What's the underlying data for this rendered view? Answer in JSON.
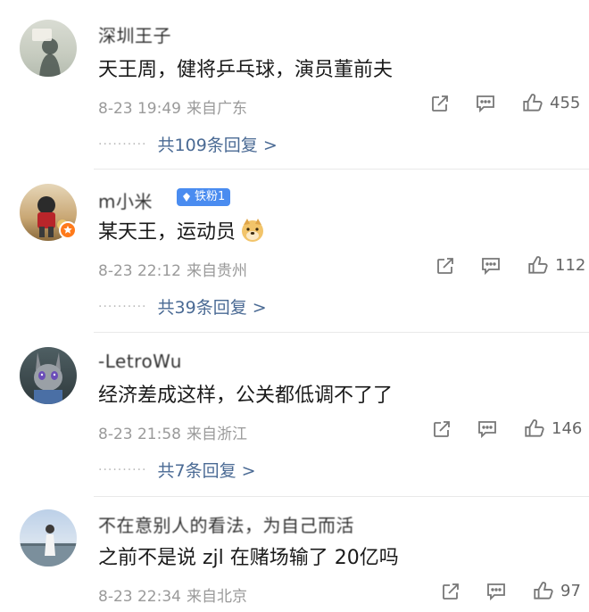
{
  "comments": [
    {
      "username": "深圳王子",
      "badge": "",
      "text": "天王周，健将乒乓球，演员董前夫",
      "date": "8-23 19:49",
      "location": "来自广东",
      "likes": "455",
      "replies": "共109条回复 >"
    },
    {
      "username": "m小米",
      "badge": "铁粉1",
      "text": "某天王，运动员",
      "date": "8-23 22:12",
      "location": "来自贵州",
      "likes": "112",
      "replies": "共39条回复 >"
    },
    {
      "username": "-LetroWu",
      "badge": "",
      "text": "经济差成这样，公关都低调不了了",
      "date": "8-23 21:58",
      "location": "来自浙江",
      "likes": "146",
      "replies": "共7条回复 >"
    },
    {
      "username": "不在意别人的看法，为自己而活",
      "badge": "",
      "text": "之前不是说 zjl 在赌场输了 20亿吗",
      "date": "8-23 22:34",
      "location": "来自北京",
      "likes": "97",
      "replies": ""
    }
  ],
  "dots": "··········",
  "icons": [
    "share-icon",
    "comment-icon",
    "thumbs-up-icon"
  ],
  "colors": {
    "link": "#4a6a94",
    "meta": "#9a9a9a",
    "badge": "#4a8cf0"
  }
}
